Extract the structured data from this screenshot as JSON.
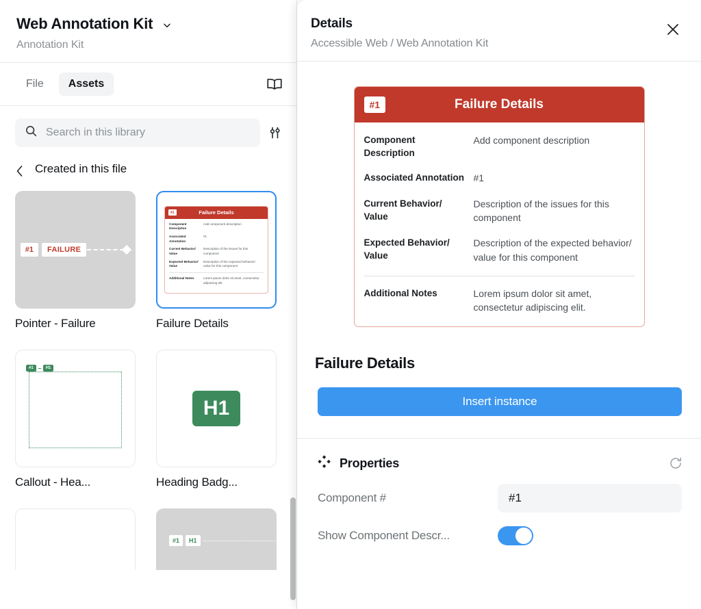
{
  "library": {
    "title": "Web Annotation Kit",
    "subtitle": "Annotation Kit",
    "dropdown_icon": "chevron-down-icon",
    "tabs": [
      {
        "label": "File",
        "active": false
      },
      {
        "label": "Assets",
        "active": true
      }
    ],
    "book_icon": "book-icon",
    "search": {
      "placeholder": "Search in this library",
      "value": "",
      "icon": "search-icon",
      "filter_icon": "filter-sliders-icon"
    },
    "breadcrumb": {
      "back_icon": "chevron-left-icon",
      "label": "Created in this file"
    },
    "assets": [
      {
        "label": "Pointer - Failure",
        "selected": false,
        "thumb_type": "pointer-failure",
        "badge": "#1",
        "tag": "FAILURE"
      },
      {
        "label": "Failure Details",
        "selected": true,
        "thumb_type": "failure-details-card"
      },
      {
        "label": "Callout - Hea...",
        "selected": false,
        "thumb_type": "callout-heading",
        "badge": "#1",
        "tag": "H1"
      },
      {
        "label": "Heading Badg...",
        "selected": false,
        "thumb_type": "heading-badge",
        "tag": "H1"
      }
    ],
    "assets_cut_off": [
      {
        "thumb_type": "blank",
        "selected": false
      },
      {
        "thumb_type": "callout-heading-gray",
        "badge": "#1",
        "tag": "H1"
      }
    ]
  },
  "details": {
    "title": "Details",
    "breadcrumb": "Accessible Web / Web Annotation Kit",
    "close_icon": "close-icon",
    "component_name": "Failure Details",
    "insert_label": "Insert instance",
    "card": {
      "number_badge": "#1",
      "header_title": "Failure Details",
      "rows": [
        {
          "key": "Component Description",
          "value": "Add component description"
        },
        {
          "key": "Associated Annotation",
          "value": "#1"
        },
        {
          "key": "Current Behavior/ Value",
          "value": "Description of the issues for this component"
        },
        {
          "key": "Expected Behavior/ Value",
          "value": "Description of the expected behavior/ value for this component"
        }
      ],
      "notes_row": {
        "key": "Additional Notes",
        "value": "Lorem ipsum dolor sit amet, consectetur adipiscing elit."
      }
    },
    "properties": {
      "icon": "component-diamond-icon",
      "title": "Properties",
      "refresh_icon": "refresh-icon",
      "items": [
        {
          "label": "Component #",
          "type": "text",
          "value": "#1"
        },
        {
          "label": "Show Component Descr...",
          "type": "toggle",
          "value": "on"
        }
      ]
    }
  },
  "colors": {
    "accent_blue": "#3b96f0",
    "failure_red": "#c0392b",
    "heading_green": "#3d8a5c",
    "selected_border": "#2e8cf0"
  }
}
